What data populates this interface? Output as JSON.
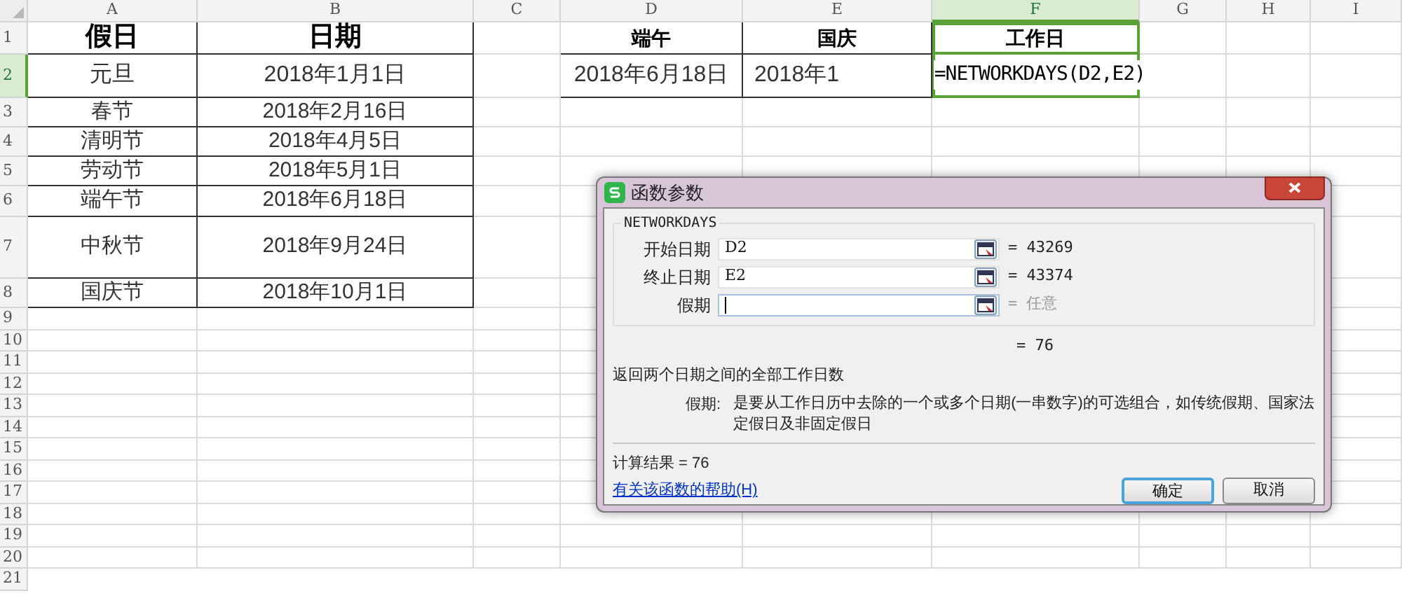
{
  "sheet": {
    "columns": [
      {
        "label": "A",
        "selected": false
      },
      {
        "label": "B",
        "selected": false
      },
      {
        "label": "C",
        "selected": false
      },
      {
        "label": "D",
        "selected": false
      },
      {
        "label": "E",
        "selected": false
      },
      {
        "label": "F",
        "selected": true
      },
      {
        "label": "G",
        "selected": false
      },
      {
        "label": "H",
        "selected": false
      },
      {
        "label": "I",
        "selected": false
      }
    ],
    "rows": [
      {
        "number": "1",
        "selected": false,
        "cells": {
          "A": "假日",
          "B": "日期",
          "D": "端午",
          "E": "国庆",
          "F": "工作日"
        }
      },
      {
        "number": "2",
        "selected": true,
        "cells": {
          "A": "元旦",
          "B": "2018年1月1日",
          "D": "2018年6月18日",
          "E": "2018年1",
          "F": "=NETWORKDAYS(D2,E2)"
        }
      },
      {
        "number": "3",
        "selected": false,
        "cells": {
          "A": "春节",
          "B": "2018年2月16日"
        }
      },
      {
        "number": "4",
        "selected": false,
        "cells": {
          "A": "清明节",
          "B": "2018年4月5日"
        }
      },
      {
        "number": "5",
        "selected": false,
        "cells": {
          "A": "劳动节",
          "B": "2018年5月1日"
        }
      },
      {
        "number": "6",
        "selected": false,
        "cells": {
          "A": "端午节",
          "B": "2018年6月18日"
        }
      },
      {
        "number": "7",
        "selected": false,
        "cells": {
          "A": "中秋节",
          "B": "2018年9月24日"
        }
      },
      {
        "number": "8",
        "selected": false,
        "cells": {
          "A": "国庆节",
          "B": "2018年10月1日"
        }
      },
      {
        "number": "9",
        "selected": false,
        "cells": {}
      },
      {
        "number": "10",
        "selected": false,
        "cells": {}
      },
      {
        "number": "11",
        "selected": false,
        "cells": {}
      },
      {
        "number": "12",
        "selected": false,
        "cells": {}
      },
      {
        "number": "13",
        "selected": false,
        "cells": {}
      },
      {
        "number": "14",
        "selected": false,
        "cells": {}
      },
      {
        "number": "15",
        "selected": false,
        "cells": {}
      },
      {
        "number": "16",
        "selected": false,
        "cells": {}
      },
      {
        "number": "17",
        "selected": false,
        "cells": {}
      },
      {
        "number": "18",
        "selected": false,
        "cells": {}
      },
      {
        "number": "19",
        "selected": false,
        "cells": {}
      },
      {
        "number": "20",
        "selected": false,
        "cells": {}
      },
      {
        "number": "21",
        "selected": false,
        "cells": {}
      }
    ]
  },
  "dialog": {
    "title": "函数参数",
    "function_name": "NETWORKDAYS",
    "arguments": [
      {
        "label": "开始日期",
        "value": "D2",
        "result": "= 43269",
        "optional": false,
        "focused": false
      },
      {
        "label": "终止日期",
        "value": "E2",
        "result": "= 43374",
        "optional": false,
        "focused": false
      },
      {
        "label": "假期",
        "result": "= 任意",
        "optional": true,
        "focused": true
      }
    ],
    "formula_result": "= 76",
    "description": "返回两个日期之间的全部工作日数",
    "argument_help": {
      "label": "假期:",
      "text": "是要从工作日历中去除的一个或多个日期(一串数字)的可选组合，如传统假期、国家法定假日及非固定假日"
    },
    "calculation": "计算结果 = 76",
    "help_link": "有关该函数的帮助(H)",
    "buttons": [
      {
        "label": "确定",
        "default": true
      },
      {
        "label": "取消",
        "default": false
      }
    ]
  }
}
